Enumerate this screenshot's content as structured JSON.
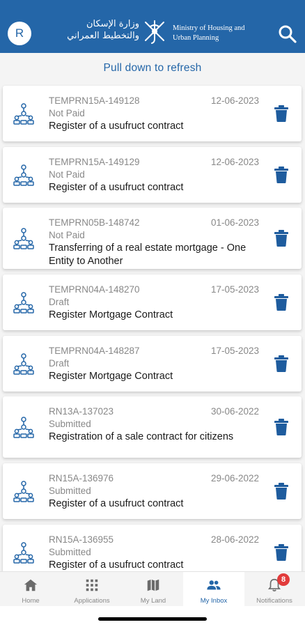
{
  "header": {
    "avatar_initial": "R",
    "ministry_name_ar": "وزارة الإسكان والتخطيط العمراني",
    "ministry_name_en": "Ministry of Housing and Urban Planning",
    "search_icon": "search-icon",
    "background_color": "#2466a8"
  },
  "refresh_text": "Pull down to refresh",
  "items": [
    {
      "id": "TEMPRN15A-149128",
      "date": "12-06-2023",
      "status": "Not Paid",
      "title": "Register of a usufruct contract"
    },
    {
      "id": "TEMPRN15A-149129",
      "date": "12-06-2023",
      "status": "Not Paid",
      "title": "Register of a usufruct contract"
    },
    {
      "id": "TEMPRN05B-148742",
      "date": "01-06-2023",
      "status": "Not Paid",
      "title": "Transferring of a real estate mortgage - One Entity to Another"
    },
    {
      "id": "TEMPRN04A-148270",
      "date": "17-05-2023",
      "status": "Draft",
      "title": "Register Mortgage Contract"
    },
    {
      "id": "TEMPRN04A-148287",
      "date": "17-05-2023",
      "status": "Draft",
      "title": "Register Mortgage Contract"
    },
    {
      "id": "RN13A-137023",
      "date": "30-06-2022",
      "status": "Submitted",
      "title": "Registration of a sale contract for citizens"
    },
    {
      "id": "RN15A-136976",
      "date": "29-06-2022",
      "status": "Submitted",
      "title": "Register of a usufruct contract"
    },
    {
      "id": "RN15A-136955",
      "date": "28-06-2022",
      "status": "Submitted",
      "title": "Register of a usufruct contract"
    }
  ],
  "tabs": [
    {
      "label": "Home",
      "icon": "home-icon"
    },
    {
      "label": "Applications",
      "icon": "grid-icon"
    },
    {
      "label": "My Land",
      "icon": "map-icon"
    },
    {
      "label": "My Inbox",
      "icon": "people-icon",
      "active": true
    },
    {
      "label": "Notifications",
      "icon": "bell-icon",
      "badge": "8"
    }
  ],
  "colors": {
    "accent": "#2466a8",
    "badge": "#e23b3b",
    "muted_text": "#888888"
  }
}
